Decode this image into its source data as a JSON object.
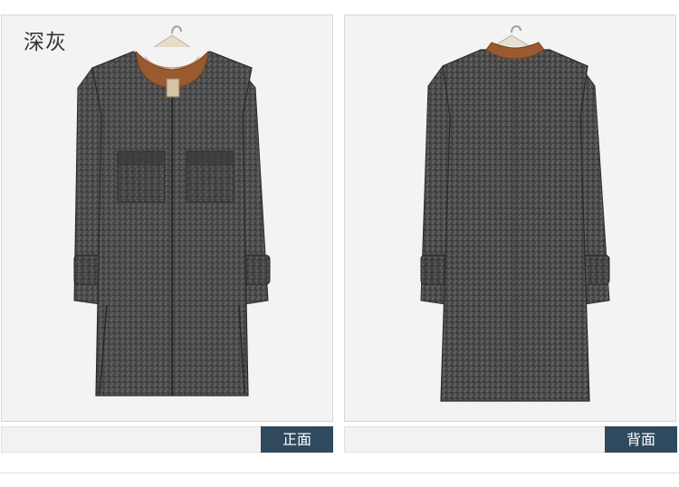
{
  "color_name": "深灰",
  "views": {
    "front_label": "正面",
    "back_label": "背面"
  },
  "colors": {
    "panel_bg": "#f3f3f3",
    "coat": "#4a4a4a",
    "coat_dark": "#303030",
    "collar": "#9a5a2f",
    "label_bg": "#2f4a5f"
  }
}
